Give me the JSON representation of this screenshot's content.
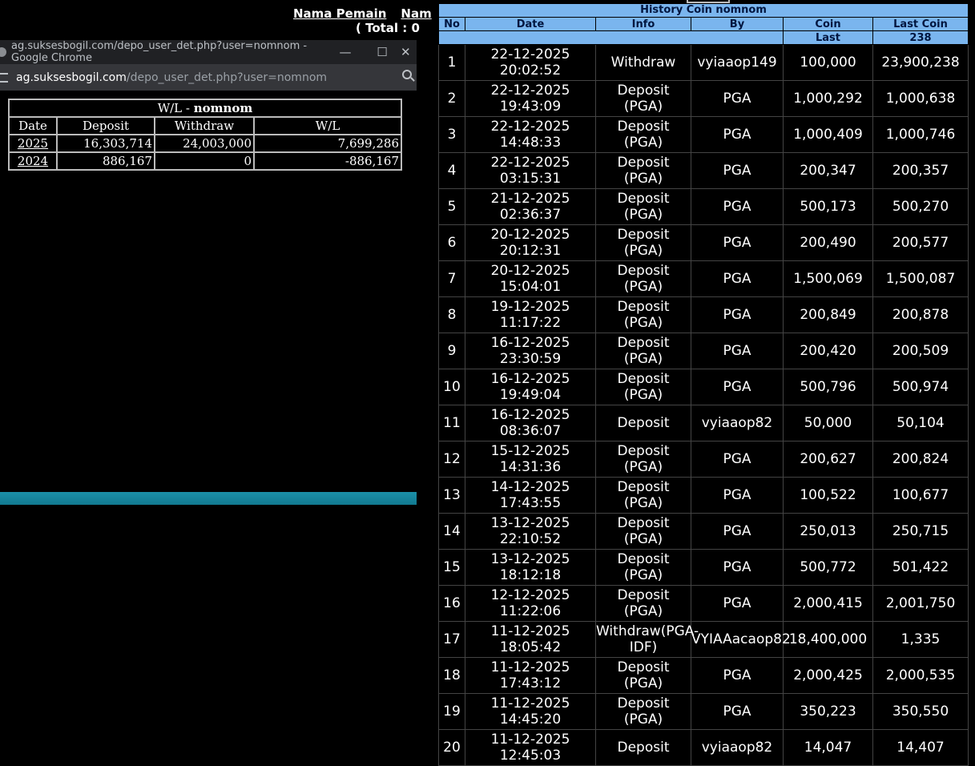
{
  "header": {
    "nama_pemain": "Nama Pemain",
    "nama_cut": "Nam",
    "total_text": "( Total : 0 "
  },
  "popup": {
    "window_title": "ag.suksesbogil.com/depo_user_det.php?user=nomnom - Google Chrome",
    "url_domain": "ag.suksesbogil.com",
    "url_path": "/depo_user_det.php?user=nomnom",
    "minimize": "—",
    "maximize": "☐",
    "close": "✕"
  },
  "wl": {
    "title_prefix": "W/L - ",
    "title_user": "nomnom",
    "headers": [
      "Date",
      "Deposit",
      "Withdraw",
      "W/L"
    ],
    "rows": [
      {
        "date": "2025",
        "deposit": "16,303,714",
        "withdraw": "24,003,000",
        "wl": "7,699,286"
      },
      {
        "date": "2024",
        "deposit": "886,167",
        "withdraw": "0",
        "wl": "-886,167"
      }
    ]
  },
  "history": {
    "title": "History Coin nomnom",
    "headers": [
      "No",
      "Date",
      "Info",
      "By",
      "Coin",
      "Last Coin"
    ],
    "sub_last_label": "Last",
    "sub_last_value": "238",
    "rows": [
      {
        "no": "1",
        "date": "22-12-2025",
        "time": "20:02:52",
        "info": "Withdraw",
        "by": "vyiaaop149",
        "coin": "100,000",
        "last": "23,900,238"
      },
      {
        "no": "2",
        "date": "22-12-2025",
        "time": "19:43:09",
        "info": "Deposit (PGA)",
        "by": "PGA",
        "coin": "1,000,292",
        "last": "1,000,638"
      },
      {
        "no": "3",
        "date": "22-12-2025",
        "time": "14:48:33",
        "info": "Deposit (PGA)",
        "by": "PGA",
        "coin": "1,000,409",
        "last": "1,000,746"
      },
      {
        "no": "4",
        "date": "22-12-2025",
        "time": "03:15:31",
        "info": "Deposit (PGA)",
        "by": "PGA",
        "coin": "200,347",
        "last": "200,357"
      },
      {
        "no": "5",
        "date": "21-12-2025",
        "time": "02:36:37",
        "info": "Deposit (PGA)",
        "by": "PGA",
        "coin": "500,173",
        "last": "500,270"
      },
      {
        "no": "6",
        "date": "20-12-2025",
        "time": "20:12:31",
        "info": "Deposit (PGA)",
        "by": "PGA",
        "coin": "200,490",
        "last": "200,577"
      },
      {
        "no": "7",
        "date": "20-12-2025",
        "time": "15:04:01",
        "info": "Deposit (PGA)",
        "by": "PGA",
        "coin": "1,500,069",
        "last": "1,500,087"
      },
      {
        "no": "8",
        "date": "19-12-2025",
        "time": "11:17:22",
        "info": "Deposit (PGA)",
        "by": "PGA",
        "coin": "200,849",
        "last": "200,878"
      },
      {
        "no": "9",
        "date": "16-12-2025",
        "time": "23:30:59",
        "info": "Deposit (PGA)",
        "by": "PGA",
        "coin": "200,420",
        "last": "200,509"
      },
      {
        "no": "10",
        "date": "16-12-2025",
        "time": "19:49:04",
        "info": "Deposit (PGA)",
        "by": "PGA",
        "coin": "500,796",
        "last": "500,974"
      },
      {
        "no": "11",
        "date": "16-12-2025",
        "time": "08:36:07",
        "info": "Deposit",
        "by": "vyiaaop82",
        "coin": "50,000",
        "last": "50,104"
      },
      {
        "no": "12",
        "date": "15-12-2025",
        "time": "14:31:36",
        "info": "Deposit (PGA)",
        "by": "PGA",
        "coin": "200,627",
        "last": "200,824"
      },
      {
        "no": "13",
        "date": "14-12-2025",
        "time": "17:43:55",
        "info": "Deposit (PGA)",
        "by": "PGA",
        "coin": "100,522",
        "last": "100,677"
      },
      {
        "no": "14",
        "date": "13-12-2025",
        "time": "22:10:52",
        "info": "Deposit (PGA)",
        "by": "PGA",
        "coin": "250,013",
        "last": "250,715"
      },
      {
        "no": "15",
        "date": "13-12-2025",
        "time": "18:12:18",
        "info": "Deposit (PGA)",
        "by": "PGA",
        "coin": "500,772",
        "last": "501,422"
      },
      {
        "no": "16",
        "date": "12-12-2025",
        "time": "11:22:06",
        "info": "Deposit (PGA)",
        "by": "PGA",
        "coin": "2,000,415",
        "last": "2,001,750"
      },
      {
        "no": "17",
        "date": "11-12-2025",
        "time": "18:05:42",
        "info": "Withdraw(PGA-IDF)",
        "by": "VYIAAacaop82",
        "coin": "18,400,000",
        "last": "1,335"
      },
      {
        "no": "18",
        "date": "11-12-2025",
        "time": "17:43:12",
        "info": "Deposit (PGA)",
        "by": "PGA",
        "coin": "2,000,425",
        "last": "2,000,535"
      },
      {
        "no": "19",
        "date": "11-12-2025",
        "time": "14:45:20",
        "info": "Deposit (PGA)",
        "by": "PGA",
        "coin": "350,223",
        "last": "350,550"
      },
      {
        "no": "20",
        "date": "11-12-2025",
        "time": "12:45:03",
        "info": "Deposit",
        "by": "vyiaaop82",
        "coin": "14,047",
        "last": "14,407"
      }
    ]
  },
  "colors": {
    "header_bg": "#7ab5ee",
    "header_text": "#001640",
    "titlebar_bg": "#202124",
    "urlbar_bg": "#35363a",
    "scrollband": "#1b8fa8"
  }
}
